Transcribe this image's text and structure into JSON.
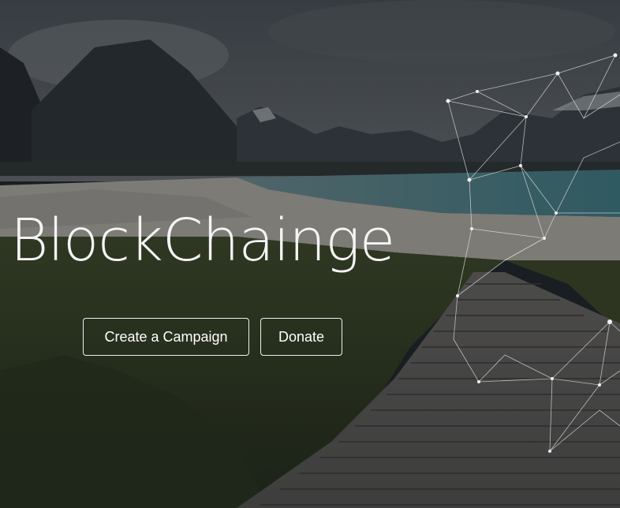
{
  "hero": {
    "title": "BlockChainge",
    "buttons": {
      "create_campaign": "Create a Campaign",
      "donate": "Donate"
    }
  },
  "colors": {
    "title_text": "#f4f4f4",
    "button_border": "#f0f0f0",
    "overlay": "rgba(20,24,28,0.35)"
  }
}
